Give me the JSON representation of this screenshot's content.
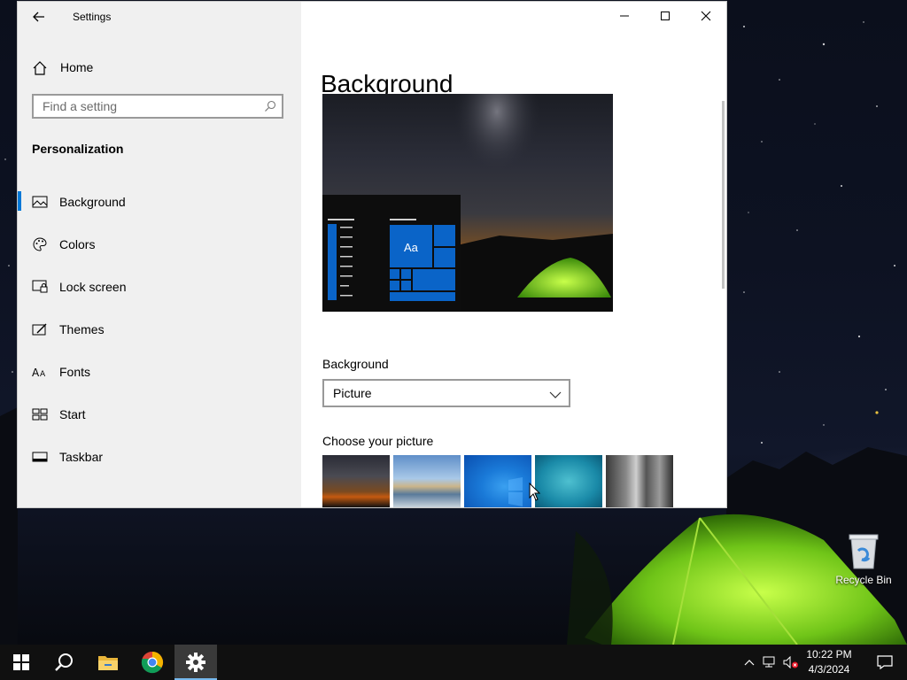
{
  "window": {
    "app_title": "Settings",
    "home_label": "Home",
    "search_placeholder": "Find a setting",
    "section_title": "Personalization",
    "nav_items": [
      {
        "label": "Background",
        "icon": "picture-icon",
        "active": true
      },
      {
        "label": "Colors",
        "icon": "palette-icon",
        "active": false
      },
      {
        "label": "Lock screen",
        "icon": "lock-screen-icon",
        "active": false
      },
      {
        "label": "Themes",
        "icon": "themes-icon",
        "active": false
      },
      {
        "label": "Fonts",
        "icon": "fonts-icon",
        "active": false
      },
      {
        "label": "Start",
        "icon": "start-icon",
        "active": false
      },
      {
        "label": "Taskbar",
        "icon": "taskbar-icon",
        "active": false
      }
    ],
    "controls": {
      "minimize": "minimize-icon",
      "maximize": "maximize-icon",
      "close": "close-icon"
    }
  },
  "main": {
    "page_title": "Background",
    "preview_tile_text": "Aa",
    "background_label": "Background",
    "background_value": "Picture",
    "choose_label": "Choose your picture"
  },
  "desktop": {
    "recycle_bin_label": "Recycle Bin"
  },
  "taskbar": {
    "time": "10:22 PM",
    "date": "4/3/2024",
    "pinned": [
      "windows-start-icon",
      "search-icon",
      "file-explorer-icon",
      "chrome-icon",
      "settings-gear-icon"
    ]
  },
  "colors": {
    "accent": "#0078d7",
    "sidebar_bg": "#f0f0f0",
    "taskbar_bg": "#101010"
  }
}
